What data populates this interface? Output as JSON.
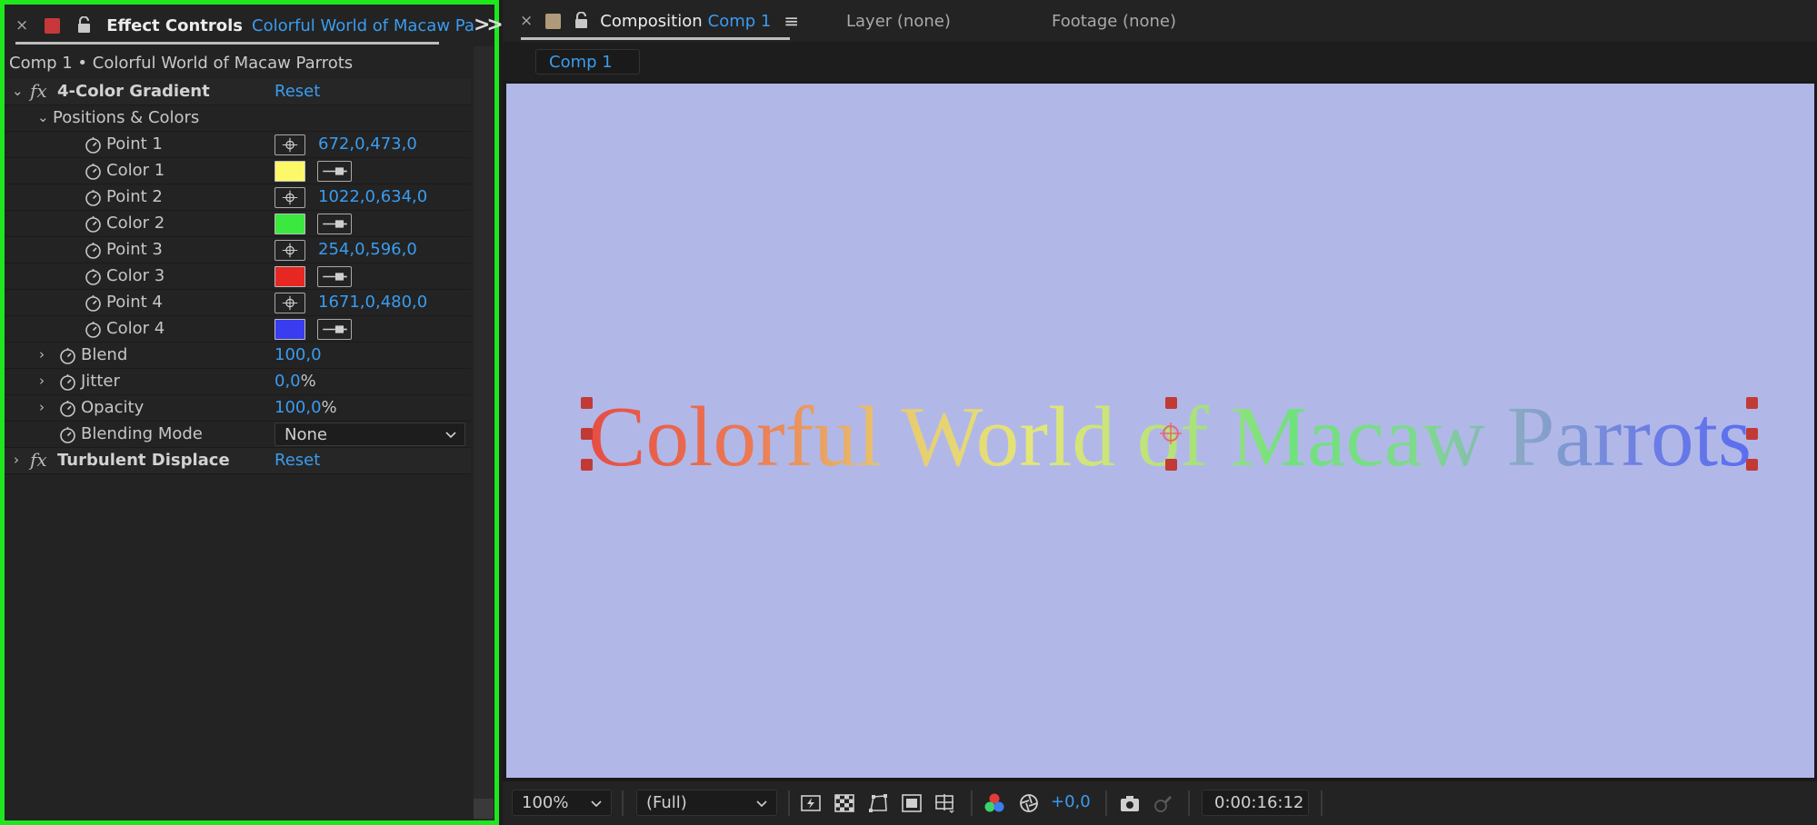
{
  "effect_controls": {
    "tab_title": "Effect Controls",
    "tab_layer": "Colorful World of Macaw Parrots",
    "breadcrumb": "Comp 1 • Colorful World of Macaw Parrots",
    "effects": [
      {
        "name": "4-Color Gradient",
        "reset": "Reset",
        "expanded": true
      },
      {
        "name": "Turbulent Displace",
        "reset": "Reset",
        "expanded": false
      }
    ],
    "group_label": "Positions & Colors",
    "params": [
      {
        "label": "Point 1",
        "kind": "point",
        "value": "672,0,473,0"
      },
      {
        "label": "Color 1",
        "kind": "color",
        "color": "#fdf868"
      },
      {
        "label": "Point 2",
        "kind": "point",
        "value": "1022,0,634,0"
      },
      {
        "label": "Color 2",
        "kind": "color",
        "color": "#3ae83f"
      },
      {
        "label": "Point 3",
        "kind": "point",
        "value": "254,0,596,0"
      },
      {
        "label": "Color 3",
        "kind": "color",
        "color": "#e72721"
      },
      {
        "label": "Point 4",
        "kind": "point",
        "value": "1671,0,480,0"
      },
      {
        "label": "Color 4",
        "kind": "color",
        "color": "#3a3cf0"
      }
    ],
    "blend": {
      "label": "Blend",
      "value": "100,0"
    },
    "jitter": {
      "label": "Jitter",
      "value": "0,0",
      "unit": "%"
    },
    "opacity": {
      "label": "Opacity",
      "value": "100,0",
      "unit": "%"
    },
    "blending_mode": {
      "label": "Blending Mode",
      "value": "None"
    }
  },
  "composition": {
    "tab_label": "Composition",
    "comp_name": "Comp 1",
    "layer_tab": "Layer (none)",
    "footage_tab": "Footage (none)",
    "subtab": "Comp 1",
    "canvas_bg": "#b1b8e8",
    "text": "Colorful World of Macaw Parrots"
  },
  "viewer_toolbar": {
    "zoom": "100%",
    "resolution": "(Full)",
    "exposure": "+0,0",
    "timecode": "0:00:16:12"
  },
  "colors": {
    "accent": "#3a9cf0",
    "panel_highlight": "#1ee71e"
  }
}
